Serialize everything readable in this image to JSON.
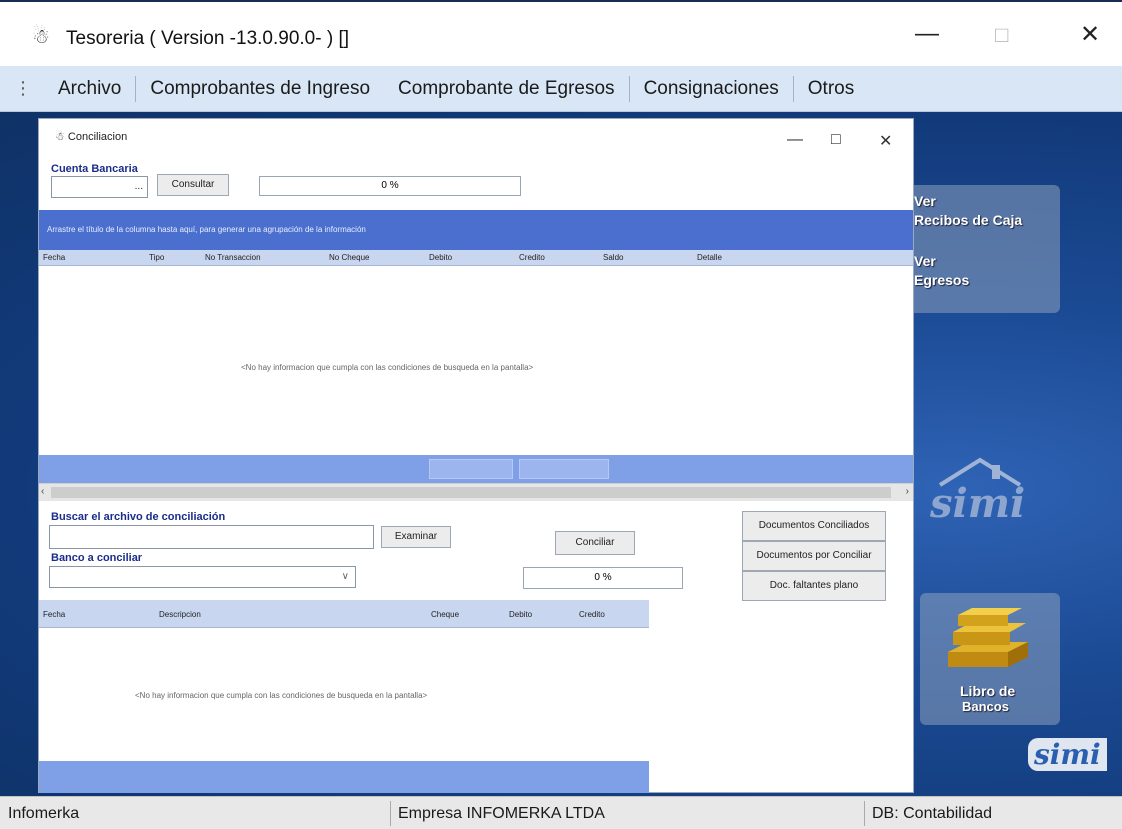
{
  "window": {
    "title": "Tesoreria  ( Version -13.0.90.0- ) []"
  },
  "menu": [
    "Archivo",
    "Comprobantes de Ingreso",
    "Comprobante de Egresos",
    "Consignaciones",
    "Otros"
  ],
  "side_tiles": {
    "recibos": [
      "Ver",
      "Recibos de Caja"
    ],
    "egresos": [
      "Ver",
      "Egresos"
    ],
    "libro": [
      "Libro de",
      "Bancos"
    ],
    "logo": "simi"
  },
  "dialog": {
    "title": "Conciliacion",
    "cuenta_label": "Cuenta Bancaria",
    "cuenta_button": "...",
    "consultar_button": "Consultar",
    "progress_top": "0 %",
    "group_hint": "Arrastre el título de la columna hasta aquí, para generar una agrupación de la información",
    "columns": [
      "Fecha",
      "Tipo",
      "No Transaccion",
      "No Cheque",
      "Debito",
      "Credito",
      "Saldo",
      "Detalle"
    ],
    "empty_message": "<No hay informacion que cumpla con las condiciones de busqueda en la pantalla>",
    "buscar_label": "Buscar el archivo de conciliación",
    "examinar_button": "Examinar",
    "banco_label": "Banco a conciliar",
    "conciliar_button": "Conciliar",
    "progress_bottom": "0 %",
    "doc_buttons": [
      "Documentos Conciliados",
      "Documentos por Conciliar",
      "Doc. faltantes plano"
    ],
    "columns2": [
      "Fecha",
      "Descripcion",
      "Cheque",
      "Debito",
      "Credito"
    ],
    "empty_message2": "<No hay informacion que cumpla con las condiciones de busqueda en la pantalla>"
  },
  "status": [
    "Infomerka",
    "Empresa INFOMERKA LTDA",
    "DB: Contabilidad"
  ]
}
